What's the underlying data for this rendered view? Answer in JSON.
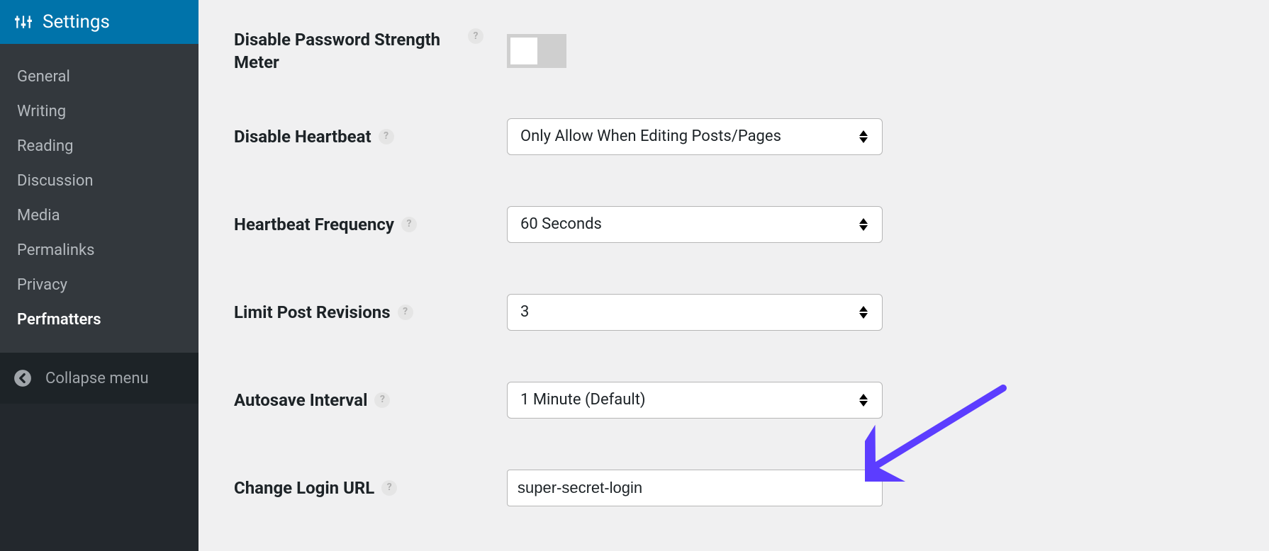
{
  "sidebar": {
    "title": "Settings",
    "items": [
      {
        "label": "General",
        "active": false
      },
      {
        "label": "Writing",
        "active": false
      },
      {
        "label": "Reading",
        "active": false
      },
      {
        "label": "Discussion",
        "active": false
      },
      {
        "label": "Media",
        "active": false
      },
      {
        "label": "Permalinks",
        "active": false
      },
      {
        "label": "Privacy",
        "active": false
      },
      {
        "label": "Perfmatters",
        "active": true
      }
    ],
    "collapse_label": "Collapse menu"
  },
  "settings": {
    "disable_pw_meter": {
      "label": "Disable Password Strength Meter",
      "value": false
    },
    "disable_heartbeat": {
      "label": "Disable Heartbeat",
      "value": "Only Allow When Editing Posts/Pages"
    },
    "heartbeat_frequency": {
      "label": "Heartbeat Frequency",
      "value": "60 Seconds"
    },
    "limit_revisions": {
      "label": "Limit Post Revisions",
      "value": "3"
    },
    "autosave_interval": {
      "label": "Autosave Interval",
      "value": "1 Minute (Default)"
    },
    "change_login_url": {
      "label": "Change Login URL",
      "value": "super-secret-login"
    }
  },
  "help_glyph": "?",
  "annotation": {
    "arrow_color": "#5c3dff"
  }
}
